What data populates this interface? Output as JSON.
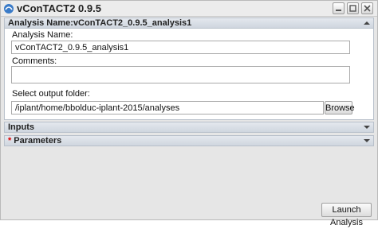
{
  "window": {
    "title": "vConTACT2 0.9.5",
    "controls": [
      "minimize-icon",
      "restore-icon",
      "close-icon"
    ]
  },
  "analysis_panel": {
    "header": "Analysis Name:vConTACT2_0.9.5_analysis1",
    "name_label": "Analysis Name:",
    "name_value": "vConTACT2_0.9.5_analysis1",
    "comments_label": "Comments:",
    "comments_value": "",
    "output_label": "Select output folder:",
    "output_value": "/iplant/home/bbolduc-iplant-2015/analyses",
    "browse_label": "Browse"
  },
  "inputs_panel": {
    "header": "Inputs"
  },
  "parameters_panel": {
    "header": "Parameters",
    "required_marker": "*"
  },
  "footer": {
    "launch_label": "Launch Analysis"
  },
  "colors": {
    "window_bg": "#e6e6e6",
    "header_bg": "#cfd6df",
    "required_star": "#dd0000"
  }
}
